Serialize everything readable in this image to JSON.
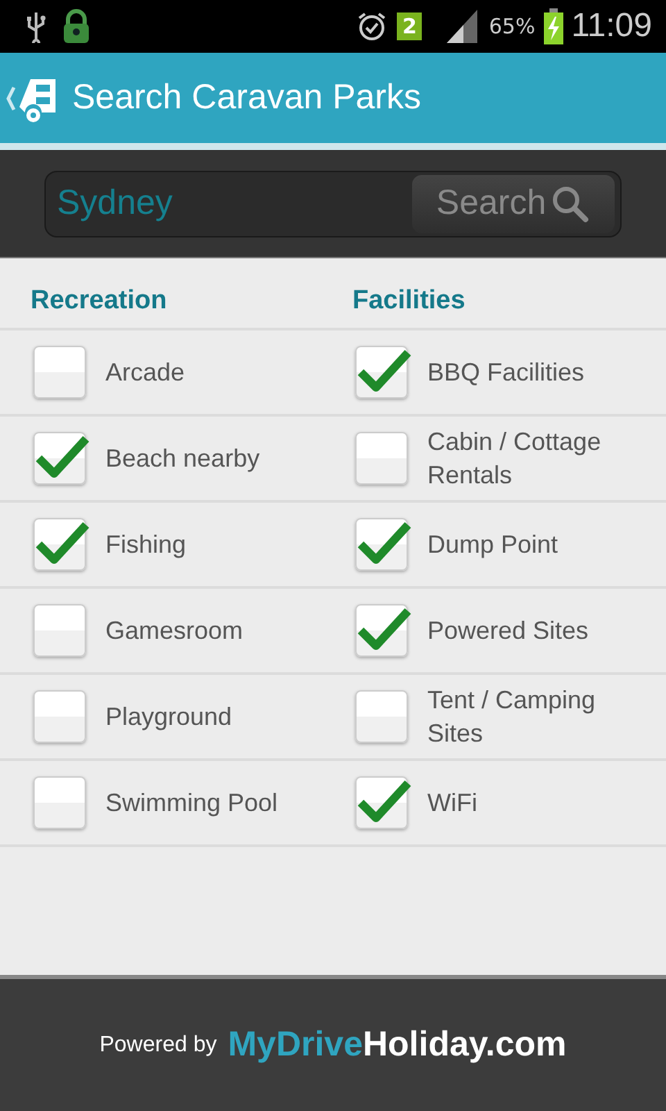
{
  "status_bar": {
    "sim_badge": "2",
    "battery": "65%",
    "time": "11:09"
  },
  "header": {
    "title": "Search Caravan Parks"
  },
  "search": {
    "value": "Sydney",
    "button": "Search"
  },
  "columns": [
    {
      "heading": "Recreation",
      "items": [
        {
          "label": "Arcade",
          "checked": false
        },
        {
          "label": "Beach nearby",
          "checked": true
        },
        {
          "label": "Fishing",
          "checked": true
        },
        {
          "label": "Gamesroom",
          "checked": false
        },
        {
          "label": "Playground",
          "checked": false
        },
        {
          "label": "Swimming Pool",
          "checked": false
        }
      ]
    },
    {
      "heading": "Facilities",
      "items": [
        {
          "label": "BBQ Facilities",
          "checked": true
        },
        {
          "label": "Cabin / Cottage Rentals",
          "checked": false
        },
        {
          "label": "Dump Point",
          "checked": true
        },
        {
          "label": "Powered Sites",
          "checked": true
        },
        {
          "label": "Tent / Camping Sites",
          "checked": false
        },
        {
          "label": "WiFi",
          "checked": true
        }
      ]
    }
  ],
  "footer": {
    "powered_by": "Powered by",
    "brand_primary": "MyDrive",
    "brand_secondary": "Holiday.com"
  }
}
